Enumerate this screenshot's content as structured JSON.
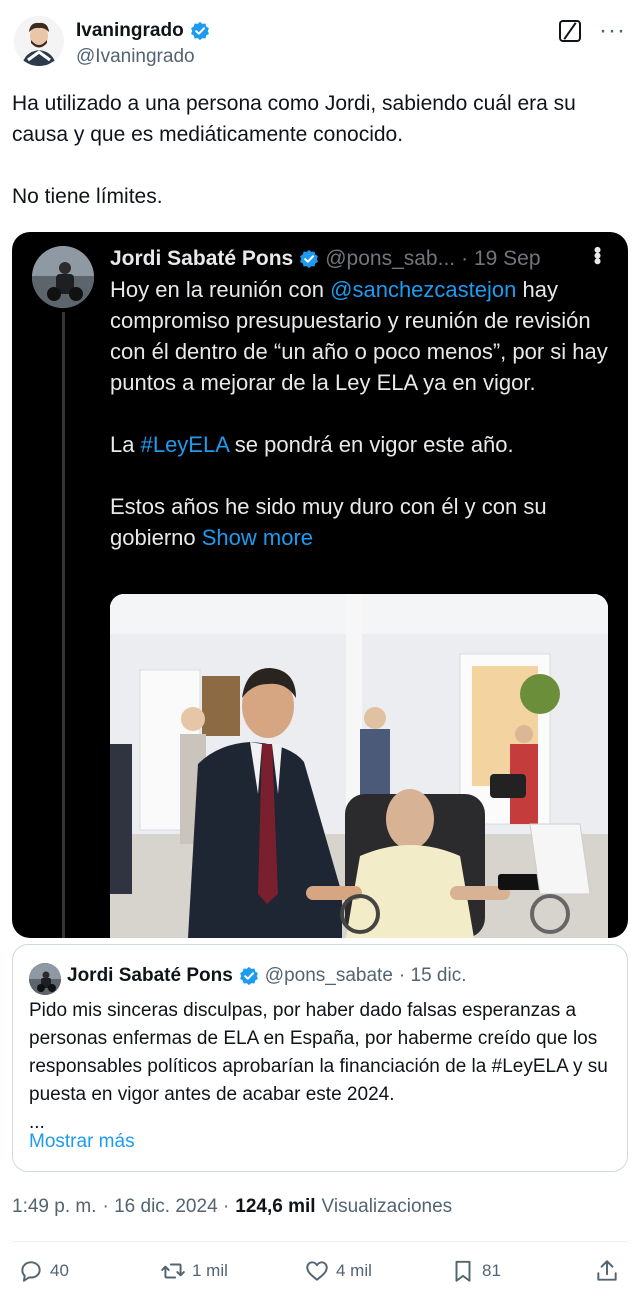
{
  "author": {
    "name": "Ivaningrado",
    "handle": "@Ivaningrado",
    "verified": true
  },
  "icons": {
    "grok": "grok-icon",
    "more": "more-dots-icon",
    "verified": "verified-badge-icon"
  },
  "tweet": {
    "text": "Ha utilizado a una persona como Jordi, sabiendo cuál era su causa y que es mediáticamente conocido.\n\nNo tiene límites."
  },
  "embedded": {
    "name": "Jordi Sabaté Pons",
    "handle": "@pons_sab...",
    "date": "· 19 Sep",
    "text_1": "Hoy en la reunión con ",
    "mention": "@sanchezcastejon",
    "text_2": " hay compromiso presupuestario y reunión de revisión con él dentro de “un año o poco menos”, por si hay puntos a mejorar de la Ley ELA ya en vigor.\n\nLa ",
    "hashtag": "#LeyELA",
    "text_3": " se pondrá en vigor este año.\n\nEstos años he sido muy duro con él y con su gobierno ",
    "show_more": "Show more"
  },
  "quote": {
    "name": "Jordi Sabaté Pons",
    "handle": "@pons_sabate",
    "date": "· 15 dic.",
    "text": "Pido mis sinceras disculpas, por haber dado falsas esperanzas a personas enfermas de ELA en España, por haberme creído que los responsables políticos aprobarían la financiación de la #LeyELA y su puesta en vigor antes de acabar este 2024.\n...",
    "more_label": "Mostrar más"
  },
  "meta": {
    "time": "1:49 p. m.",
    "date": "· 16 dic. 2024 ·",
    "views_count": "124,6 mil",
    "views_label": "Visualizaciones"
  },
  "actions": {
    "replies": "40",
    "reposts": "1 mil",
    "likes": "4 mil",
    "bookmarks": "81"
  },
  "colors": {
    "accent": "#1d9bf0",
    "text": "#0f1419",
    "muted": "#536471",
    "embed_bg": "#000000"
  }
}
